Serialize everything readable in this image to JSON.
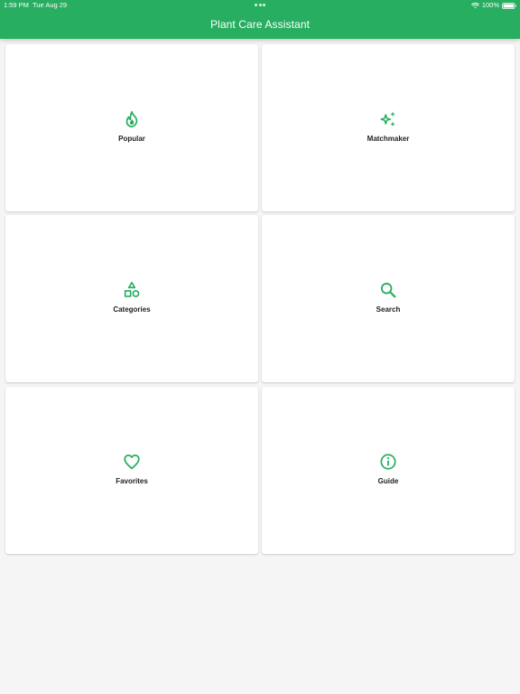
{
  "status_bar": {
    "time": "1:59 PM",
    "date": "Tue Aug 29",
    "battery": "100%"
  },
  "app_bar": {
    "title": "Plant Care Assistant"
  },
  "colors": {
    "primary": "#27ae60",
    "icon_green": "#27ae60",
    "background": "#f5f5f5",
    "card": "#ffffff"
  },
  "menu": {
    "items": [
      {
        "label": "Popular",
        "icon": "flame-icon"
      },
      {
        "label": "Matchmaker",
        "icon": "sparkles-icon"
      },
      {
        "label": "Categories",
        "icon": "shapes-icon"
      },
      {
        "label": "Search",
        "icon": "search-icon"
      },
      {
        "label": "Favorites",
        "icon": "heart-icon"
      },
      {
        "label": "Guide",
        "icon": "info-icon"
      }
    ]
  }
}
